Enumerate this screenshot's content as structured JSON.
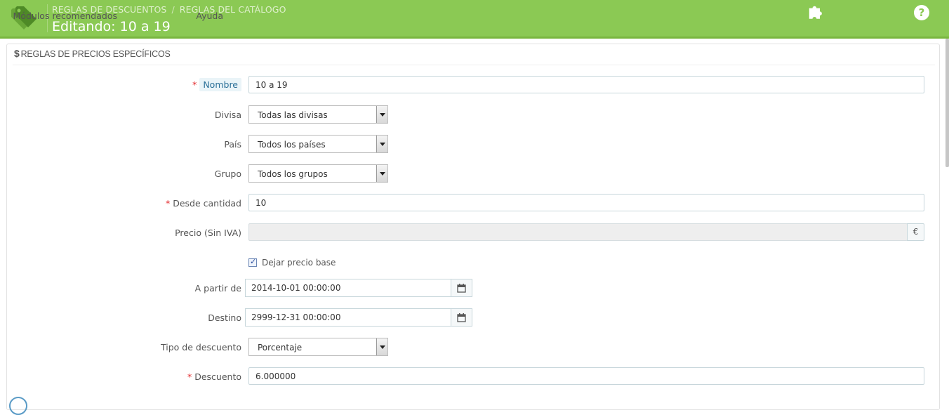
{
  "header": {
    "breadcrumb": [
      "REGLAS DE DESCUENTOS",
      "REGLAS DEL CATÁLOGO"
    ],
    "breadcrumb_separator": "/",
    "title": "Editando: 10 a 19",
    "buttons": [
      {
        "label": "Módulos recomendados",
        "icon": "puzzle-icon"
      },
      {
        "label": "Ayuda",
        "icon": "help-icon"
      }
    ]
  },
  "panel": {
    "heading_symbol": "$",
    "heading": "REGLAS DE PRECIOS ESPECÍFICOS"
  },
  "form": {
    "nombre": {
      "label": "Nombre",
      "value": "10 a 19",
      "required": true
    },
    "divisa": {
      "label": "Divisa",
      "value": "Todas las divisas"
    },
    "pais": {
      "label": "País",
      "value": "Todos los países"
    },
    "grupo": {
      "label": "Grupo",
      "value": "Todos los grupos"
    },
    "desde_cantidad": {
      "label": "Desde cantidad",
      "value": "10",
      "required": true
    },
    "precio": {
      "label": "Precio (Sin IVA)",
      "value": "",
      "addon": "€"
    },
    "dejar_precio_base": {
      "label": "Dejar precio base",
      "checked": true
    },
    "a_partir_de": {
      "label": "A partir de",
      "value": "2014-10-01 00:00:00"
    },
    "destino": {
      "label": "Destino",
      "value": "2999-12-31 00:00:00"
    },
    "tipo_descuento": {
      "label": "Tipo de descuento",
      "value": "Porcentaje"
    },
    "descuento": {
      "label": "Descuento",
      "value": "6.000000",
      "required": true
    }
  },
  "required_marker": "*",
  "colors": {
    "header_bg": "#8bc954",
    "required": "#e3292c"
  }
}
